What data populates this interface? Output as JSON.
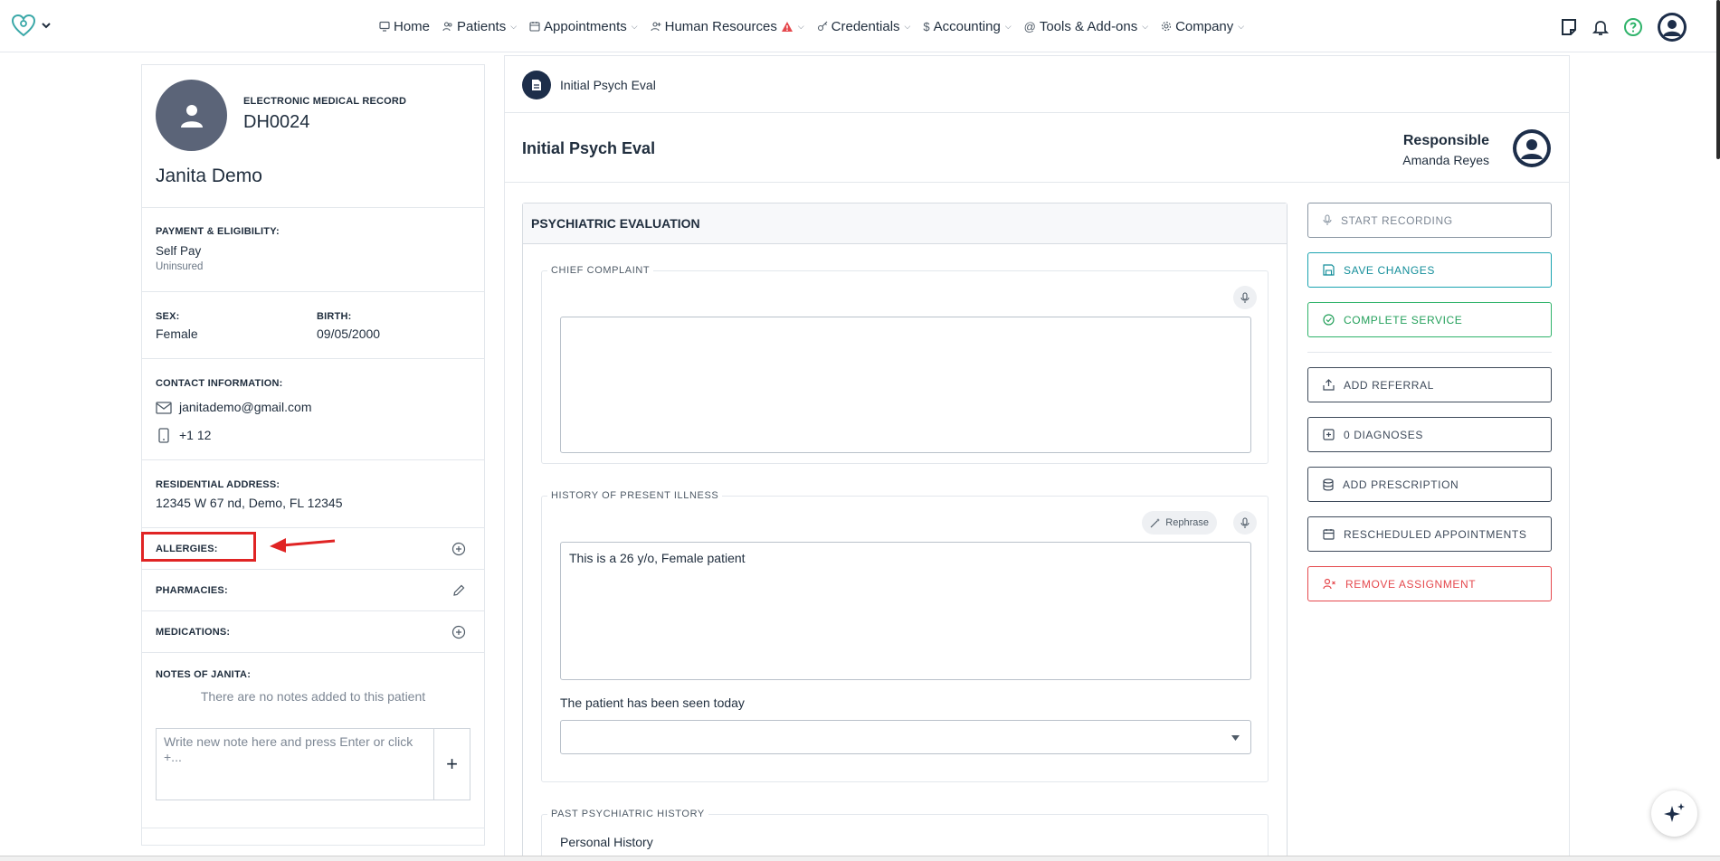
{
  "nav": {
    "items": [
      {
        "label": "Home",
        "icon": "monitor-icon"
      },
      {
        "label": "Patients",
        "icon": "users-icon"
      },
      {
        "label": "Appointments",
        "icon": "calendar-icon"
      },
      {
        "label": "Human Resources",
        "icon": "user-plus-icon"
      },
      {
        "label": "Credentials",
        "icon": "key-icon"
      },
      {
        "label": "Accounting",
        "icon": "dollar-icon"
      },
      {
        "label": "Tools & Add-ons",
        "icon": "at-icon"
      },
      {
        "label": "Company",
        "icon": "gear-icon"
      }
    ]
  },
  "patient": {
    "emr_label": "ELECTRONIC MEDICAL RECORD",
    "emr_id": "DH0024",
    "name": "Janita Demo",
    "payment_label": "PAYMENT & ELIGIBILITY:",
    "payment_value": "Self Pay",
    "payment_sub": "Uninsured",
    "sex_label": "SEX:",
    "sex_value": "Female",
    "birth_label": "BIRTH:",
    "birth_value": "09/05/2000",
    "contact_label": "CONTACT INFORMATION:",
    "email": "janitademo@gmail.com",
    "phone": "+1 12",
    "address_label": "RESIDENTIAL ADDRESS:",
    "address": "12345 W 67 nd, Demo, FL 12345",
    "allergies_label": "ALLERGIES:",
    "pharmacies_label": "PHARMACIES:",
    "medications_label": "MEDICATIONS:",
    "notes_label": "NOTES OF JANITA:",
    "notes_empty": "There are no notes added to this patient",
    "note_placeholder": "Write new note here and press Enter or click +...",
    "note_add": "+"
  },
  "main": {
    "crumb": "Initial Psych Eval",
    "title": "Initial Psych Eval",
    "responsible_label": "Responsible",
    "responsible_name": "Amanda Reyes",
    "form_title": "PSYCHIATRIC EVALUATION",
    "chief_complaint_label": "CHIEF COMPLAINT",
    "chief_complaint_value": "",
    "hpi_label": "HISTORY OF PRESENT ILLNESS",
    "hpi_value": "This is a 26 y/o, Female patient",
    "rephrase_label": "Rephrase",
    "seen_today_label": "The patient has been seen today",
    "seen_today_value": "",
    "past_psych_label": "PAST PSYCHIATRIC HISTORY",
    "personal_history_label": "Personal History"
  },
  "actions": {
    "start_recording": "START RECORDING",
    "save_changes": "SAVE CHANGES",
    "complete_service": "COMPLETE SERVICE",
    "add_referral": "ADD REFERRAL",
    "diagnoses": "0 DIAGNOSES",
    "add_prescription": "ADD PRESCRIPTION",
    "rescheduled": "RESCHEDULED APPOINTMENTS",
    "remove_assignment": "REMOVE ASSIGNMENT"
  },
  "colors": {
    "accent_teal": "#1aa3b0",
    "success_green": "#2fb36a",
    "danger_red": "#e5484d",
    "navy": "#1d2e4a",
    "highlight_red": "#e02424"
  }
}
